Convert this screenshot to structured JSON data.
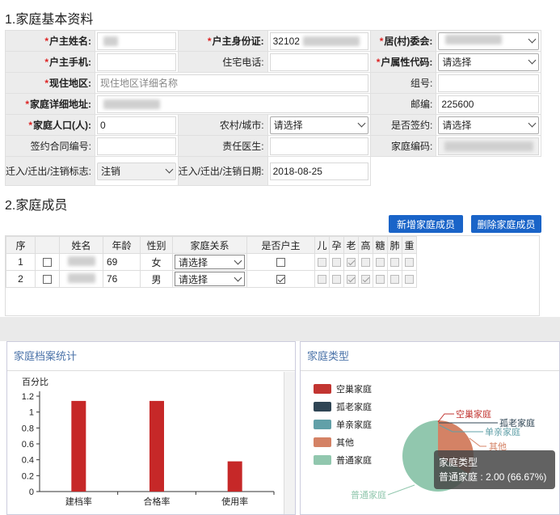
{
  "section1_title": "1.家庭基本资料",
  "section2_title": "2.家庭成员",
  "info": {
    "head_name_label": "户主姓名:",
    "head_name_value": "",
    "head_id_label": "户主身份证:",
    "head_id_value": "32102",
    "committee_label": "居(村)委会:",
    "committee_value": "",
    "head_phone_label": "户主手机:",
    "head_phone_value": "",
    "home_phone_label": "住宅电话:",
    "home_phone_value": "",
    "household_code_label": "户属性代码:",
    "household_code_value": "请选择",
    "address_label": "现住地区:",
    "address_placeholder": "现住地区详细名称",
    "group_label": "组号:",
    "group_value": "",
    "detail_address_label": "家庭详细地址:",
    "detail_address_value": "",
    "postcode_label": "邮编:",
    "postcode_value": "225600",
    "population_label": "家庭人口(人):",
    "population_value": "0",
    "urban_rural_label": "农村/城市:",
    "urban_rural_value": "请选择",
    "signed_label": "是否签约:",
    "signed_value": "请选择",
    "contract_label": "签约合同编号:",
    "contract_value": "",
    "doctor_label": "责任医生:",
    "doctor_value": "",
    "family_code_label": "家庭编码:",
    "family_code_value": "",
    "move_flag_label": "迁入/迁出/注销标志:",
    "move_flag_value": "注销",
    "move_date_label": "迁入/迁出/注销日期:",
    "move_date_value": "2018-08-25"
  },
  "buttons": {
    "add_member": "新增家庭成员",
    "delete_member": "删除家庭成员"
  },
  "members": {
    "headers": [
      "序",
      "",
      "姓名",
      "年龄",
      "性别",
      "家庭关系",
      "是否户主",
      "儿",
      "孕",
      "老",
      "高",
      "糖",
      "肺",
      "重"
    ],
    "rows": [
      {
        "no": "1",
        "age": "69",
        "gender": "女",
        "relation": "请选择",
        "is_head": false,
        "flags": [
          false,
          false,
          true,
          false,
          false,
          false,
          false
        ]
      },
      {
        "no": "2",
        "age": "76",
        "gender": "男",
        "relation": "请选择",
        "is_head": true,
        "flags": [
          false,
          false,
          true,
          true,
          false,
          false,
          false
        ]
      }
    ]
  },
  "panel_left_title": "家庭档案统计",
  "panel_right_title": "家庭类型",
  "chart_data": [
    {
      "type": "bar",
      "ylabel": "百分比",
      "categories": [
        "建档率",
        "合格率",
        "使用率"
      ],
      "values": [
        1.14,
        1.14,
        0.38
      ],
      "ylim": [
        0,
        1.2
      ],
      "yticks": [
        "0",
        "0.2",
        "0.4",
        "0.6",
        "0.8",
        "1",
        "1.2"
      ],
      "color": "#c62828"
    },
    {
      "type": "pie",
      "title": "家庭类型",
      "categories": [
        "空巢家庭",
        "孤老家庭",
        "单亲家庭",
        "其他",
        "普通家庭"
      ],
      "values": [
        0,
        0,
        0,
        1,
        2
      ],
      "colors": [
        "#c23531",
        "#2f4554",
        "#61a0a8",
        "#d48265",
        "#91c7ae"
      ],
      "tooltip_title": "家庭类型",
      "tooltip_text": "普通家庭 : 2.00 (66.67%)"
    }
  ]
}
